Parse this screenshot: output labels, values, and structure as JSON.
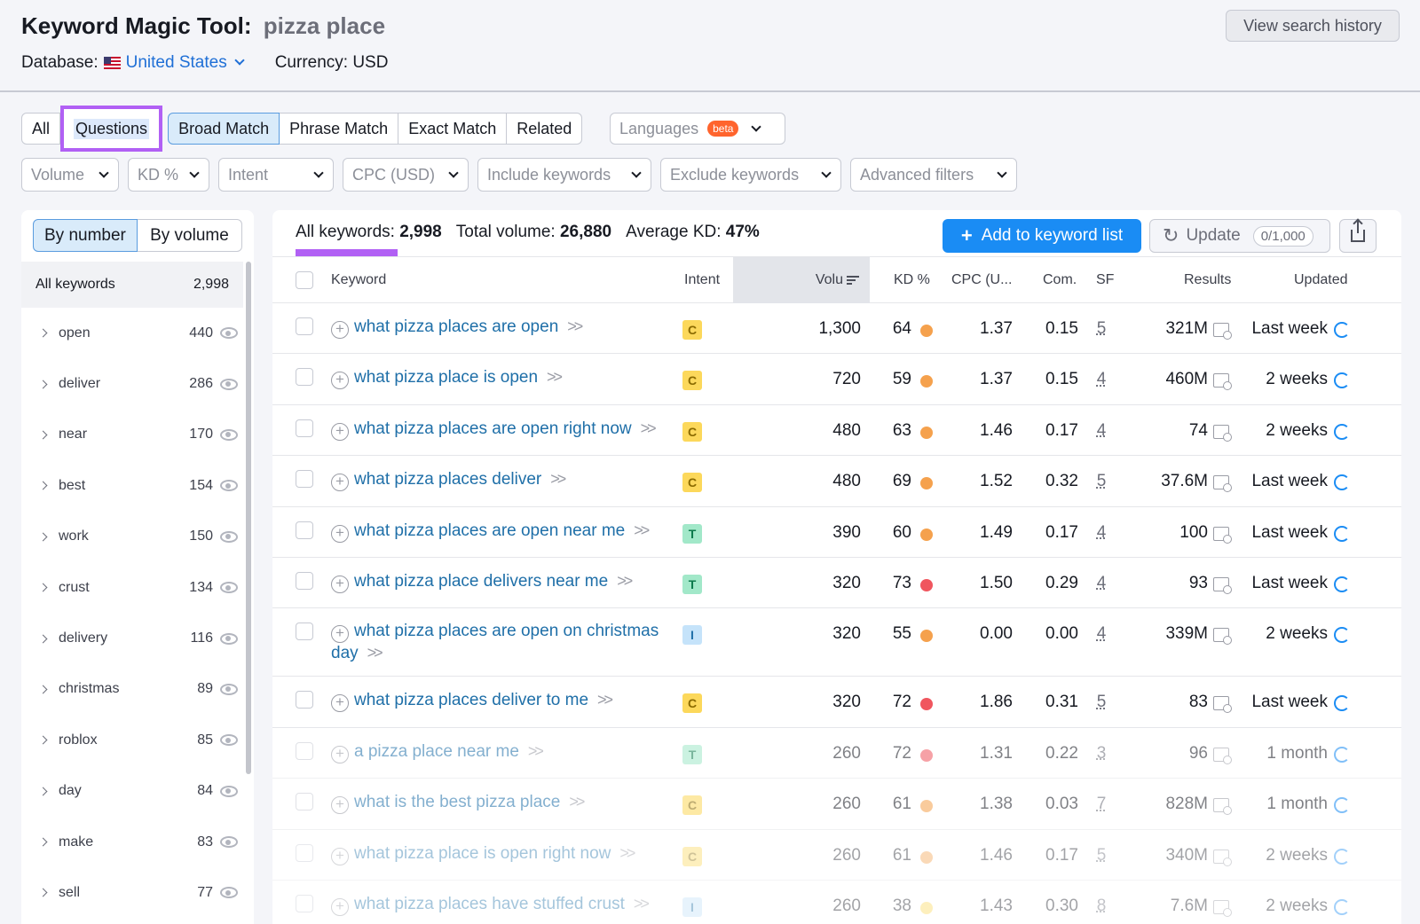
{
  "header": {
    "title": "Keyword Magic Tool:",
    "query": "pizza place",
    "database_label": "Database:",
    "database_value": "United States",
    "currency": "Currency: USD",
    "history_button": "View search history"
  },
  "match_tabs": {
    "all": "All",
    "questions": "Questions",
    "broad": "Broad Match",
    "phrase": "Phrase Match",
    "exact": "Exact Match",
    "related": "Related",
    "languages": "Languages",
    "beta": "beta"
  },
  "filters": [
    "Volume",
    "KD %",
    "Intent",
    "CPC (USD)",
    "Include keywords",
    "Exclude keywords",
    "Advanced filters"
  ],
  "sidebar": {
    "by_number": "By number",
    "by_volume": "By volume",
    "all_keywords_label": "All keywords",
    "all_keywords_count": "2,998",
    "groups": [
      {
        "name": "open",
        "count": "440"
      },
      {
        "name": "deliver",
        "count": "286"
      },
      {
        "name": "near",
        "count": "170"
      },
      {
        "name": "best",
        "count": "154"
      },
      {
        "name": "work",
        "count": "150"
      },
      {
        "name": "crust",
        "count": "134"
      },
      {
        "name": "delivery",
        "count": "116"
      },
      {
        "name": "christmas",
        "count": "89"
      },
      {
        "name": "roblox",
        "count": "85"
      },
      {
        "name": "day",
        "count": "84"
      },
      {
        "name": "make",
        "count": "83"
      },
      {
        "name": "sell",
        "count": "77"
      }
    ]
  },
  "stats": {
    "all_keywords_label": "All keywords:",
    "all_keywords_value": "2,998",
    "total_volume_label": "Total volume:",
    "total_volume_value": "26,880",
    "avg_kd_label": "Average KD:",
    "avg_kd_value": "47%"
  },
  "actions": {
    "add": "Add to keyword list",
    "update": "Update",
    "update_count": "0/1,000"
  },
  "columns": {
    "keyword": "Keyword",
    "intent": "Intent",
    "volume": "Volu",
    "kd": "KD %",
    "cpc": "CPC (U...",
    "com": "Com.",
    "sf": "SF",
    "results": "Results",
    "updated": "Updated"
  },
  "colors": {
    "kd_orange": "#f5a14d",
    "kd_red": "#f0565e",
    "kd_yellow": "#fcd85b",
    "accent": "#1a8cf4",
    "highlight": "#b160f4"
  },
  "rows": [
    {
      "keyword": "what pizza places are open",
      "intent": "C",
      "volume": "1,300",
      "kd": "64",
      "kd_color": "#f5a14d",
      "cpc": "1.37",
      "com": "0.15",
      "sf": "5",
      "results": "321M",
      "updated": "Last week"
    },
    {
      "keyword": "what pizza place is open",
      "intent": "C",
      "volume": "720",
      "kd": "59",
      "kd_color": "#f5a14d",
      "cpc": "1.37",
      "com": "0.15",
      "sf": "4",
      "results": "460M",
      "updated": "2 weeks"
    },
    {
      "keyword": "what pizza places are open right now",
      "intent": "C",
      "volume": "480",
      "kd": "63",
      "kd_color": "#f5a14d",
      "cpc": "1.46",
      "com": "0.17",
      "sf": "4",
      "results": "74",
      "updated": "2 weeks"
    },
    {
      "keyword": "what pizza places deliver",
      "intent": "C",
      "volume": "480",
      "kd": "69",
      "kd_color": "#f5a14d",
      "cpc": "1.52",
      "com": "0.32",
      "sf": "5",
      "results": "37.6M",
      "updated": "Last week"
    },
    {
      "keyword": "what pizza places are open near me",
      "intent": "T",
      "volume": "390",
      "kd": "60",
      "kd_color": "#f5a14d",
      "cpc": "1.49",
      "com": "0.17",
      "sf": "4",
      "results": "100",
      "updated": "Last week"
    },
    {
      "keyword": "what pizza place delivers near me",
      "intent": "T",
      "volume": "320",
      "kd": "73",
      "kd_color": "#f0565e",
      "cpc": "1.50",
      "com": "0.29",
      "sf": "4",
      "results": "93",
      "updated": "Last week"
    },
    {
      "keyword": "what pizza places are open on christmas day",
      "intent": "I",
      "volume": "320",
      "kd": "55",
      "kd_color": "#f5a14d",
      "cpc": "0.00",
      "com": "0.00",
      "sf": "4",
      "results": "339M",
      "updated": "2 weeks"
    },
    {
      "keyword": "what pizza places deliver to me",
      "intent": "C",
      "volume": "320",
      "kd": "72",
      "kd_color": "#f0565e",
      "cpc": "1.86",
      "com": "0.31",
      "sf": "5",
      "results": "83",
      "updated": "Last week"
    },
    {
      "keyword": "a pizza place near me",
      "intent": "T",
      "volume": "260",
      "kd": "72",
      "kd_color": "#f0565e",
      "cpc": "1.31",
      "com": "0.22",
      "sf": "3",
      "results": "96",
      "updated": "1 month"
    },
    {
      "keyword": "what is the best pizza place",
      "intent": "C",
      "volume": "260",
      "kd": "61",
      "kd_color": "#f5a14d",
      "cpc": "1.38",
      "com": "0.03",
      "sf": "7",
      "results": "828M",
      "updated": "1 month"
    },
    {
      "keyword": "what pizza place is open right now",
      "intent": "C",
      "volume": "260",
      "kd": "61",
      "kd_color": "#f5a14d",
      "cpc": "1.46",
      "com": "0.17",
      "sf": "5",
      "results": "340M",
      "updated": "2 weeks"
    },
    {
      "keyword": "what pizza places have stuffed crust",
      "intent": "I",
      "volume": "260",
      "kd": "38",
      "kd_color": "#fcd85b",
      "cpc": "1.43",
      "com": "0.30",
      "sf": "8",
      "results": "7.6M",
      "updated": "2 weeks"
    }
  ]
}
